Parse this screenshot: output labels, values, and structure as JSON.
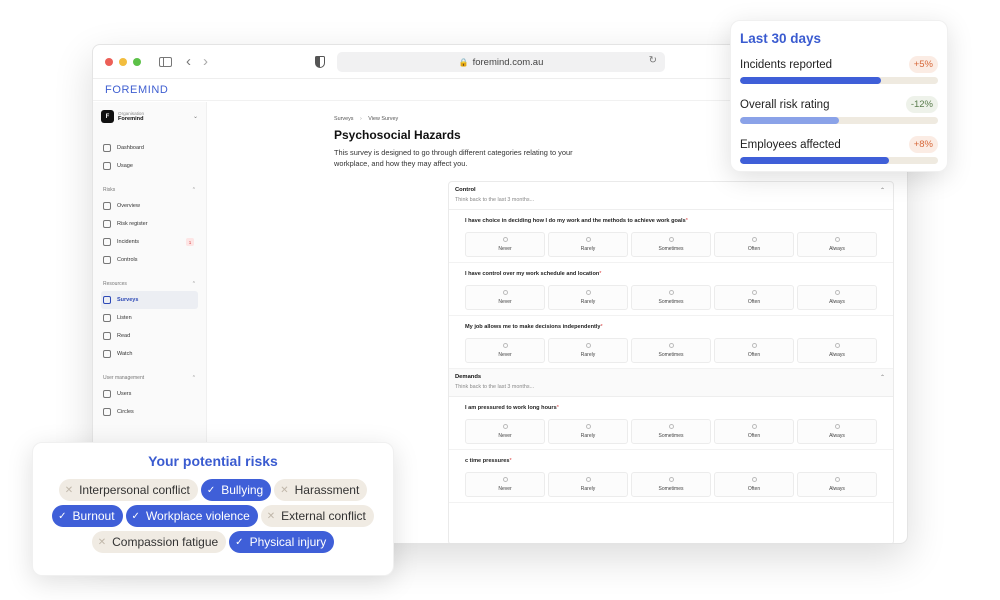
{
  "browser": {
    "url": "foremind.com.au"
  },
  "app": {
    "logo": "FOREMIND"
  },
  "sidebar": {
    "org_label": "Organisation",
    "org_name": "Foremind",
    "org_initial": "F",
    "items_top": [
      {
        "label": "Dashboard",
        "icon": "home-icon"
      },
      {
        "label": "Usage",
        "icon": "chart-icon"
      }
    ],
    "risks_section": "Risks",
    "risks_items": [
      {
        "label": "Overview",
        "icon": "grid-icon"
      },
      {
        "label": "Risk register",
        "icon": "list-icon"
      },
      {
        "label": "Incidents",
        "icon": "warning-icon",
        "badge": "1"
      },
      {
        "label": "Controls",
        "icon": "clipboard-icon"
      }
    ],
    "resources_section": "Resources",
    "resources_items": [
      {
        "label": "Surveys",
        "icon": "survey-icon",
        "active": true
      },
      {
        "label": "Listen",
        "icon": "music-icon"
      },
      {
        "label": "Read",
        "icon": "document-icon"
      },
      {
        "label": "Watch",
        "icon": "film-icon"
      }
    ],
    "users_section": "User management",
    "users_items": [
      {
        "label": "Users",
        "icon": "users-icon"
      },
      {
        "label": "Circles",
        "icon": "circles-icon"
      }
    ]
  },
  "main": {
    "breadcrumb_1": "Surveys",
    "breadcrumb_2": "View Survey",
    "title": "Psychosocial Hazards",
    "description": "This survey is designed to go through different categories relating to your workplace, and how they may affect you.",
    "options": [
      "Never",
      "Rarely",
      "Sometimes",
      "Often",
      "Always"
    ],
    "control": {
      "title": "Control",
      "subtitle": "Think back to the last 3 months...",
      "questions": [
        "I have choice in deciding how I do my work and the methods to achieve work goals",
        "I have control over my work schedule and location",
        "My job allows me to make decisions independently"
      ]
    },
    "demands": {
      "title": "Demands",
      "subtitle": "Think back to the last 3 months...",
      "questions": [
        "I am pressured to work long hours",
        "c time pressures"
      ]
    }
  },
  "stats": {
    "title": "Last 30 days",
    "rows": [
      {
        "label": "Incidents reported",
        "change": "+5%",
        "direction": "up",
        "level": 0.71,
        "color": "#3f5fd8"
      },
      {
        "label": "Overall risk rating",
        "change": "-12%",
        "direction": "down",
        "level": 0.5,
        "color": "#8aa2e8"
      },
      {
        "label": "Employees affected",
        "change": "+8%",
        "direction": "up",
        "level": 0.75,
        "color": "#3f5fd8"
      }
    ]
  },
  "risks": {
    "title": "Your potential risks",
    "tags": [
      {
        "label": "Interpersonal conflict",
        "selected": false
      },
      {
        "label": "Bullying",
        "selected": true
      },
      {
        "label": "Harassment",
        "selected": false
      },
      {
        "label": "Burnout",
        "selected": true
      },
      {
        "label": "Workplace violence",
        "selected": true
      },
      {
        "label": "External conflict",
        "selected": false
      },
      {
        "label": "Compassion fatigue",
        "selected": false
      },
      {
        "label": "Physical injury",
        "selected": true
      }
    ]
  }
}
